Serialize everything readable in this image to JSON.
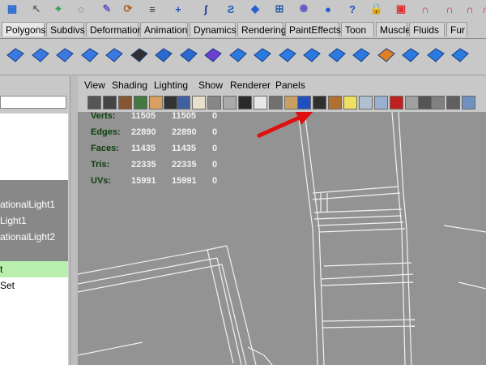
{
  "shelf_tabs": [
    {
      "label": "Polygons",
      "active": true
    },
    {
      "label": "Subdivs",
      "active": false
    },
    {
      "label": "Deformation",
      "active": false
    },
    {
      "label": "Animation",
      "active": false
    },
    {
      "label": "Dynamics",
      "active": false
    },
    {
      "label": "Rendering",
      "active": false
    },
    {
      "label": "PaintEffects",
      "active": false
    },
    {
      "label": "Toon",
      "active": false
    },
    {
      "label": "Muscle",
      "active": false
    },
    {
      "label": "Fluids",
      "active": false
    },
    {
      "label": "Fur",
      "active": false
    }
  ],
  "panel_menu": [
    "View",
    "Shading",
    "Lighting",
    "Show",
    "Renderer",
    "Panels"
  ],
  "outliner": {
    "items": [
      {
        "label": "",
        "highlight": "gray"
      },
      {
        "label": "ationalLight1",
        "highlight": "gray"
      },
      {
        "label": "Light1",
        "highlight": "gray"
      },
      {
        "label": "ationalLight2",
        "highlight": "gray"
      },
      {
        "label": "",
        "highlight": "gray"
      },
      {
        "label": "t",
        "highlight": "green"
      },
      {
        "label": "Set",
        "highlight": "none"
      }
    ]
  },
  "hud": {
    "rows": [
      {
        "label": "Verts:",
        "v1": "11505",
        "v2": "11505",
        "v3": "0"
      },
      {
        "label": "Edges:",
        "v1": "22890",
        "v2": "22890",
        "v3": "0"
      },
      {
        "label": "Faces:",
        "v1": "11435",
        "v2": "11435",
        "v3": "0"
      },
      {
        "label": "Tris:",
        "v1": "22335",
        "v2": "22335",
        "v3": "0"
      },
      {
        "label": "UVs:",
        "v1": "15991",
        "v2": "15991",
        "v3": "0"
      }
    ]
  },
  "top_icons": [
    "grid-icon",
    "select-icon",
    "snap-icon",
    "lasso-icon",
    "paint-icon",
    "history-icon",
    "menu-icon",
    "plus-icon",
    "curve-icon",
    "spiral-icon",
    "cube-icon",
    "snap-grid-icon",
    "fuzzy-icon",
    "sphere-icon",
    "help-icon",
    "lock-icon",
    "render-icon",
    "magnet-icon",
    "magnet-icon",
    "magnet-icon",
    "magnet-icon"
  ],
  "shelf_icons": [
    "plane-icon",
    "torus-icon",
    "pyramid-icon",
    "cylinder-icon",
    "mesh-icon",
    "circle-icon",
    "extract-icon",
    "split-icon",
    "combine-icon",
    "smooth-icon",
    "bevel-icon",
    "extrude-icon",
    "cut-icon",
    "wedge-icon",
    "bridge-icon",
    "fill-icon",
    "append-icon",
    "poke-icon",
    "chamfer-icon"
  ],
  "colors": {
    "viewport_bg": "#939393",
    "hud_label": "#0c3f0c",
    "hud_value": "#f0f0f0",
    "outliner_gray": "#888888",
    "outliner_green": "#b9f0b0",
    "annotation_arrow": "#e01010",
    "wireframe": "#f2f2f2"
  }
}
